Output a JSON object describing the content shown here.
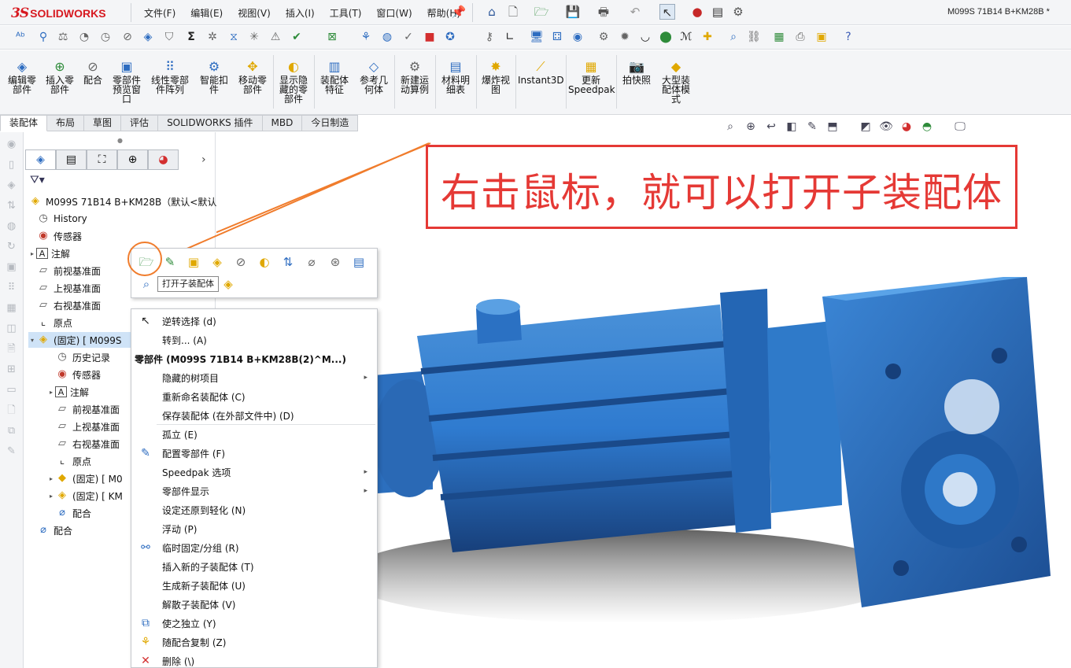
{
  "app": {
    "logo_ds": "3S",
    "logo_text": "SOLIDWORKS",
    "document_title": "M099S 71B14 B+KM28B *"
  },
  "menu": [
    "文件(F)",
    "编辑(E)",
    "视图(V)",
    "插入(I)",
    "工具(T)",
    "窗口(W)",
    "帮助(H)"
  ],
  "command_manager": [
    {
      "label": "编辑零\n部件",
      "icon": "edit-component-icon"
    },
    {
      "label": "插入零\n部件",
      "icon": "insert-components-icon"
    },
    {
      "label": "配合",
      "icon": "mate-icon"
    },
    {
      "label": "零部件\n预览窗\n口",
      "icon": "component-preview-icon"
    },
    {
      "label": "线性零部\n件阵列",
      "icon": "linear-pattern-icon"
    },
    {
      "label": "智能扣\n件",
      "icon": "smart-fasteners-icon"
    },
    {
      "label": "移动零\n部件",
      "icon": "move-component-icon"
    },
    {
      "label": "显示隐\n藏的零\n部件",
      "icon": "show-hidden-icon"
    },
    {
      "label": "装配体\n特征",
      "icon": "assembly-features-icon"
    },
    {
      "label": "参考几\n何体",
      "icon": "reference-geometry-icon"
    },
    {
      "label": "新建运\n动算例",
      "icon": "motion-study-icon"
    },
    {
      "label": "材料明\n细表",
      "icon": "bom-icon"
    },
    {
      "label": "爆炸视\n图",
      "icon": "exploded-view-icon"
    },
    {
      "label": "Instant3D",
      "icon": "instant3d-icon"
    },
    {
      "label": "更新\nSpeedpak",
      "icon": "speedpak-icon"
    },
    {
      "label": "拍快照",
      "icon": "snapshot-icon"
    },
    {
      "label": "大型装\n配体模\n式",
      "icon": "large-assembly-icon"
    }
  ],
  "tabs": [
    "装配体",
    "布局",
    "草图",
    "评估",
    "SOLIDWORKS 插件",
    "MBD",
    "今日制造"
  ],
  "tree": {
    "root": "M099S 71B14 B+KM28B（默认<默认",
    "items": [
      {
        "label": "History",
        "icon": "history-icon",
        "level": 1,
        "expand": ""
      },
      {
        "label": "传感器",
        "icon": "sensor-icon",
        "level": 1,
        "expand": ""
      },
      {
        "label": "注解",
        "icon": "annotation-icon",
        "level": 1,
        "expand": "▸"
      },
      {
        "label": "前视基准面",
        "icon": "plane-icon",
        "level": 1,
        "expand": ""
      },
      {
        "label": "上视基准面",
        "icon": "plane-icon",
        "level": 1,
        "expand": ""
      },
      {
        "label": "右视基准面",
        "icon": "plane-icon",
        "level": 1,
        "expand": ""
      },
      {
        "label": "原点",
        "icon": "origin-icon",
        "level": 1,
        "expand": ""
      },
      {
        "label": "(固定) [ M099S",
        "icon": "subassembly-icon",
        "level": 1,
        "expand": "▾",
        "selected": true
      },
      {
        "label": "历史记录",
        "icon": "history-icon",
        "level": 2,
        "expand": ""
      },
      {
        "label": "传感器",
        "icon": "sensor-icon",
        "level": 2,
        "expand": ""
      },
      {
        "label": "注解",
        "icon": "annotation-icon",
        "level": 2,
        "expand": "▸"
      },
      {
        "label": "前视基准面",
        "icon": "plane-icon",
        "level": 2,
        "expand": ""
      },
      {
        "label": "上视基准面",
        "icon": "plane-icon",
        "level": 2,
        "expand": ""
      },
      {
        "label": "右视基准面",
        "icon": "plane-icon",
        "level": 2,
        "expand": ""
      },
      {
        "label": "原点",
        "icon": "origin-icon",
        "level": 2,
        "expand": ""
      },
      {
        "label": "(固定) [ M0",
        "icon": "part-icon",
        "level": 2,
        "expand": "▸"
      },
      {
        "label": "(固定) [ KM",
        "icon": "subassembly-icon",
        "level": 2,
        "expand": "▸"
      },
      {
        "label": "配合",
        "icon": "mates-icon",
        "level": 2,
        "expand": ""
      },
      {
        "label": "配合",
        "icon": "mates-icon",
        "level": 1,
        "expand": ""
      }
    ]
  },
  "annotation_text": "右击鼠标，就可以打开子装配体",
  "context_toolbar": {
    "tooltip": "打开子装配体"
  },
  "context_menu": {
    "items": [
      {
        "label": "逆转选择 (d)",
        "icon": "cursor-icon",
        "submenu": false
      },
      {
        "label": "转到... (A)",
        "icon": "",
        "submenu": false
      },
      {
        "label": "零部件 (M099S 71B14 B+KM28B(2)^M...)",
        "icon": "",
        "submenu": false,
        "header": true
      },
      {
        "label": "隐藏的树项目",
        "icon": "",
        "submenu": true
      },
      {
        "label": "重新命名装配体 (C)",
        "icon": "",
        "submenu": false
      },
      {
        "label": "保存装配体 (在外部文件中) (D)",
        "icon": "",
        "submenu": false
      },
      {
        "label": "孤立 (E)",
        "icon": "",
        "submenu": false
      },
      {
        "label": "配置零部件 (F)",
        "icon": "configure-icon",
        "submenu": false
      },
      {
        "label": "Speedpak 选项",
        "icon": "",
        "submenu": true
      },
      {
        "label": "零部件显示",
        "icon": "",
        "submenu": true
      },
      {
        "label": "设定还原到轻化 (N)",
        "icon": "",
        "submenu": false
      },
      {
        "label": "浮动 (P)",
        "icon": "",
        "submenu": false
      },
      {
        "label": "临时固定/分组 (R)",
        "icon": "temp-fix-icon",
        "submenu": false
      },
      {
        "label": "插入新的子装配体 (T)",
        "icon": "",
        "submenu": false
      },
      {
        "label": "生成新子装配体 (U)",
        "icon": "",
        "submenu": false
      },
      {
        "label": "解散子装配体 (V)",
        "icon": "",
        "submenu": false
      },
      {
        "label": "使之独立 (Y)",
        "icon": "make-independent-icon",
        "submenu": false
      },
      {
        "label": "随配合复制 (Z)",
        "icon": "copy-with-mates-icon",
        "submenu": false
      },
      {
        "label": "删除 (\\)",
        "icon": "delete-icon",
        "submenu": false
      }
    ]
  }
}
